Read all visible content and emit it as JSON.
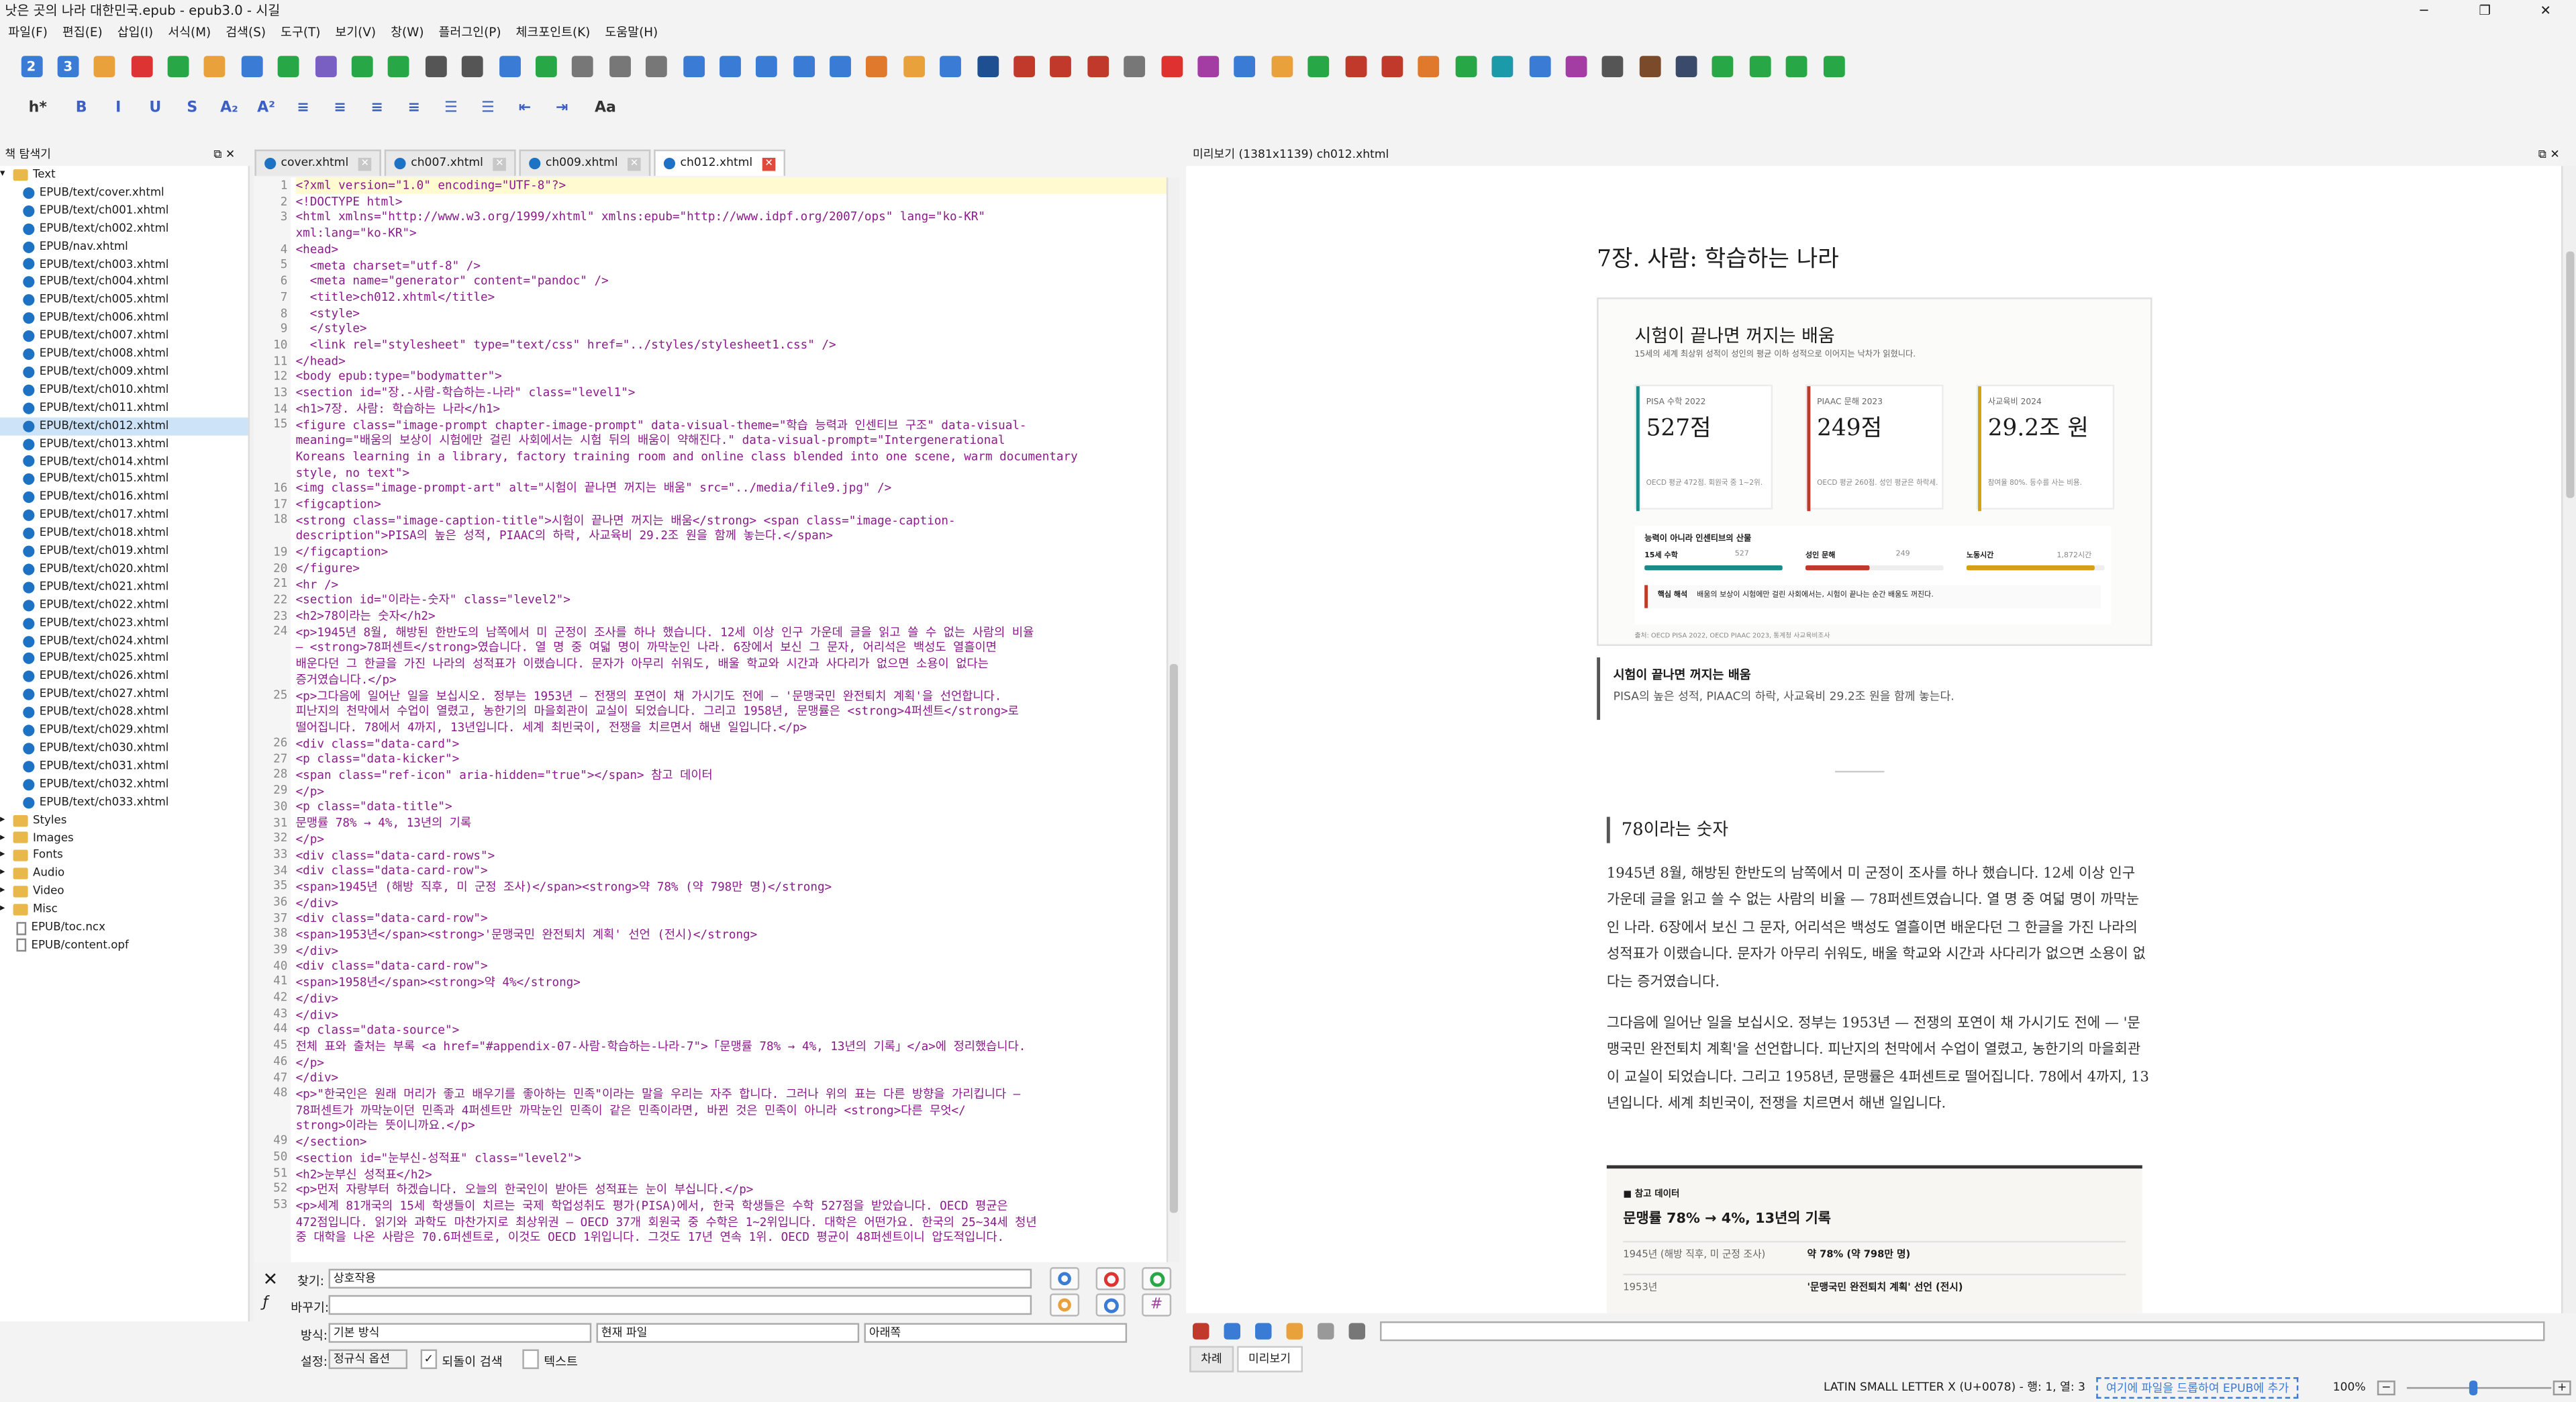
{
  "window": {
    "title": "낫은 곳의 나라 대한민국.epub - epub3.0 - 시길"
  },
  "menu": [
    "파일(F)",
    "편집(E)",
    "삽입(I)",
    "서식(M)",
    "검색(S)",
    "도구(T)",
    "보기(V)",
    "창(W)",
    "플러그인(P)",
    "체크포인트(K)",
    "도움말(H)"
  ],
  "toolbar_icons": [
    "heading-2-icon",
    "heading-3-icon",
    "open-icon",
    "save-icon",
    "add-file-icon",
    "up-icon",
    "refresh-icon",
    "add-icon",
    "gear-icon",
    "import-icon",
    "add-existing-icon",
    "metadata-icon",
    "merge-icon",
    "undo-icon",
    "redo-icon",
    "cut-icon",
    "copy-icon",
    "paste-icon",
    "code-icon",
    "close-tag-icon",
    "search-icon",
    "zoom-icon",
    "image-icon",
    "media-icon",
    "omega-icon",
    "anchor-icon",
    "spellcheck-icon",
    "replace-icon",
    "link-icon",
    "bookmark-icon",
    "back-icon",
    "heart-icon",
    "mail-icon",
    "list-icon",
    "toc-icon",
    "abc-check-icon",
    "plugin-1-icon",
    "plugin-2-icon",
    "plugin-3-icon",
    "plugin-4-icon",
    "plugin-5-icon",
    "plugin-6-icon",
    "plugin-7-icon",
    "plugin-8-icon",
    "plugin-9-icon",
    "plugin-10-icon",
    "plugin-11-icon",
    "tag-1-icon",
    "tag-2-icon",
    "tag-3-icon"
  ],
  "toolbar_colors": [
    "#3a7bd5",
    "#3a7bd5",
    "#e9a23b",
    "#d33",
    "#27a745",
    "#e9a23b",
    "#3a7bd5",
    "#27a745",
    "#7a5fc2",
    "#27a745",
    "#27a745",
    "#555",
    "#555",
    "#3a7bd5",
    "#27a745",
    "#777",
    "#777",
    "#777",
    "#3a7bd5",
    "#3a7bd5",
    "#3a7bd5",
    "#3a7bd5",
    "#3a7bd5",
    "#e0792b",
    "#e9a23b",
    "#3a7bd5",
    "#1d4f91",
    "#c0392b",
    "#c0392b",
    "#c0392b",
    "#777",
    "#e03131",
    "#a33da3",
    "#3a7bd5",
    "#e9a23b",
    "#27a745",
    "#c0392b",
    "#c0392b",
    "#e0792b",
    "#27a745",
    "#1b9aaa",
    "#3a7bd5",
    "#a33da3",
    "#555",
    "#7a4a2a",
    "#3a4a6a",
    "#27a745",
    "#27a745",
    "#27a745",
    "#27a745"
  ],
  "toolbar_badges": [
    "2",
    "3"
  ],
  "format_toolbar": [
    "h*",
    "B",
    "I",
    "U",
    "S",
    "A₂",
    "A²",
    "≡",
    "≡",
    "≡",
    "≡",
    "☰",
    "☰",
    "⇤",
    "⇥",
    "Aa"
  ],
  "explorer": {
    "title": "책 탐색기",
    "root": "Text",
    "files": [
      "EPUB/text/cover.xhtml",
      "EPUB/text/ch001.xhtml",
      "EPUB/text/ch002.xhtml",
      "EPUB/nav.xhtml",
      "EPUB/text/ch003.xhtml",
      "EPUB/text/ch004.xhtml",
      "EPUB/text/ch005.xhtml",
      "EPUB/text/ch006.xhtml",
      "EPUB/text/ch007.xhtml",
      "EPUB/text/ch008.xhtml",
      "EPUB/text/ch009.xhtml",
      "EPUB/text/ch010.xhtml",
      "EPUB/text/ch011.xhtml",
      "EPUB/text/ch012.xhtml",
      "EPUB/text/ch013.xhtml",
      "EPUB/text/ch014.xhtml",
      "EPUB/text/ch015.xhtml",
      "EPUB/text/ch016.xhtml",
      "EPUB/text/ch017.xhtml",
      "EPUB/text/ch018.xhtml",
      "EPUB/text/ch019.xhtml",
      "EPUB/text/ch020.xhtml",
      "EPUB/text/ch021.xhtml",
      "EPUB/text/ch022.xhtml",
      "EPUB/text/ch023.xhtml",
      "EPUB/text/ch024.xhtml",
      "EPUB/text/ch025.xhtml",
      "EPUB/text/ch026.xhtml",
      "EPUB/text/ch027.xhtml",
      "EPUB/text/ch028.xhtml",
      "EPUB/text/ch029.xhtml",
      "EPUB/text/ch030.xhtml",
      "EPUB/text/ch031.xhtml",
      "EPUB/text/ch032.xhtml",
      "EPUB/text/ch033.xhtml"
    ],
    "selected_index": 13,
    "folders": [
      "Styles",
      "Images",
      "Fonts",
      "Audio",
      "Video",
      "Misc"
    ],
    "extra": [
      "EPUB/toc.ncx",
      "EPUB/content.opf"
    ]
  },
  "tabs": [
    {
      "label": "cover.xhtml"
    },
    {
      "label": "ch007.xhtml"
    },
    {
      "label": "ch009.xhtml"
    },
    {
      "label": "ch012.xhtml",
      "active": true
    }
  ],
  "code_lines": [
    "<?xml version=\"1.0\" encoding=\"UTF-8\"?>",
    "<!DOCTYPE html>",
    "<html xmlns=\"http://www.w3.org/1999/xhtml\" xmlns:epub=\"http://www.idpf.org/2007/ops\" lang=\"ko-KR\"",
    "xml:lang=\"ko-KR\">",
    "<head>",
    "  <meta charset=\"utf-8\" />",
    "  <meta name=\"generator\" content=\"pandoc\" />",
    "  <title>ch012.xhtml</title>",
    "  <style>",
    "  </style>",
    "  <link rel=\"stylesheet\" type=\"text/css\" href=\"../styles/stylesheet1.css\" />",
    "</head>",
    "<body epub:type=\"bodymatter\">",
    "<section id=\"장.-사람-학습하는-나라\" class=\"level1\">",
    "<h1>7장. 사람: 학습하는 나라</h1>",
    "<figure class=\"image-prompt chapter-image-prompt\" data-visual-theme=\"학습 능력과 인센티브 구조\" data-visual-",
    "meaning=\"배움의 보상이 시험에만 걸린 사회에서는 시험 뒤의 배움이 약해진다.\" data-visual-prompt=\"Intergenerational",
    "Koreans learning in a library, factory training room and online class blended into one scene, warm documentary",
    "style, no text\">",
    "<img class=\"image-prompt-art\" alt=\"시험이 끝나면 꺼지는 배움\" src=\"../media/file9.jpg\" />",
    "<figcaption>",
    "<strong class=\"image-caption-title\">시험이 끝나면 꺼지는 배움</strong> <span class=\"image-caption-",
    "description\">PISA의 높은 성적, PIAAC의 하락, 사교육비 29.2조 원을 함께 놓는다.</span>",
    "</figcaption>",
    "</figure>",
    "<hr />",
    "<section id=\"이라는-숫자\" class=\"level2\">",
    "<h2>78이라는 숫자</h2>",
    "<p>1945년 8월, 해방된 한반도의 남쪽에서 미 군정이 조사를 하나 했습니다. 12세 이상 인구 가운데 글을 읽고 쓸 수 없는 사람의 비율",
    "— <strong>78퍼센트</strong>였습니다. 열 명 중 여덟 명이 까막눈인 나라. 6장에서 보신 그 문자, 어리석은 백성도 열흘이면",
    "배운다던 그 한글을 가진 나라의 성적표가 이랬습니다. 문자가 아무리 쉬워도, 배울 학교와 시간과 사다리가 없으면 소용이 없다는",
    "증거였습니다.</p>",
    "<p>그다음에 일어난 일을 보십시오. 정부는 1953년 — 전쟁의 포연이 채 가시기도 전에 — '문맹국민 완전퇴치 계획'을 선언합니다.",
    "피난지의 천막에서 수업이 열렸고, 농한기의 마을회관이 교실이 되었습니다. 그리고 1958년, 문맹률은 <strong>4퍼센트</strong>로",
    "떨어집니다. 78에서 4까지, 13년입니다. 세계 최빈국이, 전쟁을 치르면서 해낸 일입니다.</p>",
    "<div class=\"data-card\">",
    "<p class=\"data-kicker\">",
    "<span class=\"ref-icon\" aria-hidden=\"true\"></span> 참고 데이터",
    "</p>",
    "<p class=\"data-title\">",
    "문맹률 78% → 4%, 13년의 기록",
    "</p>",
    "<div class=\"data-card-rows\">",
    "<div class=\"data-card-row\">",
    "<span>1945년 (해방 직후, 미 군정 조사)</span><strong>약 78% (약 798만 명)</strong>",
    "</div>",
    "<div class=\"data-card-row\">",
    "<span>1953년</span><strong>'문맹국민 완전퇴치 계획' 선언 (전시)</strong>",
    "</div>",
    "<div class=\"data-card-row\">",
    "<span>1958년</span><strong>약 4%</strong>",
    "</div>",
    "</div>",
    "<p class=\"data-source\">",
    "전체 표와 출처는 부록 <a href=\"#appendix-07-사람-학습하는-나라-7\">「문맹률 78% → 4%, 13년의 기록」</a>에 정리했습니다.",
    "</p>",
    "</div>",
    "<p>\"한국인은 원래 머리가 좋고 배우기를 좋아하는 민족\"이라는 말을 우리는 자주 합니다. 그러나 위의 표는 다른 방향을 가리킵니다 —",
    "78퍼센트가 까막눈이던 민족과 4퍼센트만 까막눈인 민족이 같은 민족이라면, 바뀐 것은 민족이 아니라 <strong>다른 무엇</",
    "strong>이라는 뜻이니까요.</p>",
    "</section>",
    "<section id=\"눈부신-성적표\" class=\"level2\">",
    "<h2>눈부신 성적표</h2>",
    "<p>먼저 자랑부터 하겠습니다. 오늘의 한국인이 받아든 성적표는 눈이 부십니다.</p>",
    "<p>세계 81개국의 15세 학생들이 치르는 국제 학업성취도 평가(PISA)에서, 한국 학생들은 수학 527점을 받았습니다. OECD 평균은",
    "472점입니다. 읽기와 과학도 마찬가지로 최상위권 — OECD 37개 회원국 중 수학은 1~2위입니다. 대학은 어떤가요. 한국의 25~34세 청년",
    "중 대학을 나온 사람은 70.6퍼센트로, 이것도 OECD 1위입니다. 그것도 17년 연속 1위. OECD 평균이 48퍼센트이니 압도적입니다."
  ],
  "gutter_numbers": [
    "1",
    "2",
    "3",
    "",
    "4",
    "5",
    "6",
    "7",
    "8",
    "9",
    "10",
    "11",
    "12",
    "13",
    "14",
    "15",
    "",
    "",
    "",
    "16",
    "17",
    "18",
    "",
    "19",
    "20",
    "21",
    "22",
    "23",
    "24",
    "",
    "",
    "",
    "25",
    "",
    "",
    "26",
    "27",
    "28",
    "29",
    "30",
    "31",
    "32",
    "33",
    "34",
    "35",
    "36",
    "37",
    "38",
    "39",
    "40",
    "41",
    "42",
    "43",
    "44",
    "45",
    "46",
    "47",
    "48",
    "",
    "",
    "49",
    "50",
    "51",
    "52",
    "53",
    "",
    "",
    ""
  ],
  "find": {
    "find_label": "찾기:",
    "find_value": "상호작용",
    "replace_label": "바꾸기:",
    "replace_value": "",
    "mode_label": "방식:",
    "mode_value": "기본 방식",
    "scope_value": "현재 파일",
    "direction_value": "아래쪽",
    "settings_label": "설정:",
    "regex_option": "정규식 옵션",
    "wrap_label": "되돌이 검색",
    "text_label": "텍스트"
  },
  "preview": {
    "title": "미리보기 (1381x1139) ch012.xhtml",
    "h1": "7장. 사람: 학습하는 나라",
    "infographic": {
      "title": "시험이 끝나면 꺼지는 배움",
      "subtitle": "15세의 세계 최상위 성적이 성인의 평균 이하 성적으로 이어지는 낙차가 읽혔니다.",
      "stats": [
        {
          "label": "PISA 수학 2022",
          "value": "527점",
          "note": "OECD 평균 472점. 회원국 중 1~2위.",
          "color": "#1b8a8a"
        },
        {
          "label": "PIAAC 문해 2023",
          "value": "249점",
          "note": "OECD 평균 260점. 성인 평균은 하락세.",
          "color": "#c0392b"
        },
        {
          "label": "사교육비 2024",
          "value": "29.2조 원",
          "note": "참여율 80%. 등수를 사는 비용.",
          "color": "#d4a017"
        }
      ],
      "chain_title": "능력이 아니라 인센티브의 산물",
      "chain": [
        {
          "label": "15세 수학",
          "value": "527",
          "color": "#1b8a8a",
          "fill": 1.0
        },
        {
          "label": "성인 문해",
          "value": "249",
          "color": "#c0392b",
          "fill": 0.47
        },
        {
          "label": "노동시간",
          "value": "1,872시간",
          "color": "#d4a017",
          "fill": 0.93
        }
      ],
      "insight_label": "핵심 해석",
      "insight": "배움의 보상이 시험에만 걸린 사회에서는, 시험이 끝나는 순간 배움도 꺼진다.",
      "source": "출처: OECD PISA 2022, OECD PIAAC 2023, 통계청 사교육비조사"
    },
    "caption_title": "시험이 끝나면 꺼지는 배움",
    "caption_desc": "PISA의 높은 성적, PIAAC의 하락, 사교육비 29.2조 원을 함께 놓는다.",
    "h2": "78이라는 숫자",
    "p1": "1945년 8월, 해방된 한반도의 남쪽에서 미 군정이 조사를 하나 했습니다. 12세 이상 인구 가운데 글을 읽고 쓸 수 없는 사람의 비율 — 78퍼센트였습니다. 열 명 중 여덟 명이 까막눈인 나라. 6장에서 보신 그 문자, 어리석은 백성도 열흘이면 배운다던 그 한글을 가진 나라의 성적표가 이랬습니다. 문자가 아무리 쉬워도, 배울 학교와 시간과 사다리가 없으면 소용이 없다는 증거였습니다.",
    "p2": "그다음에 일어난 일을 보십시오. 정부는 1953년 — 전쟁의 포연이 채 가시기도 전에 — '문맹국민 완전퇴치 계획'을 선언합니다. 피난지의 천막에서 수업이 열렸고, 농한기의 마을회관이 교실이 되었습니다. 그리고 1958년, 문맹률은 4퍼센트로 떨어집니다. 78에서 4까지, 13년입니다. 세계 최빈국이, 전쟁을 치르면서 해낸 일입니다.",
    "datacard": {
      "kicker": "참고 데이터",
      "title": "문맹률 78% → 4%, 13년의 기록",
      "rows": [
        {
          "k": "1945년 (해방 직후, 미 군정 조사)",
          "v": "약 78% (약 798만 명)"
        },
        {
          "k": "1953년",
          "v": "'문맹국민 완전퇴치 계획' 선언 (전시)"
        }
      ]
    }
  },
  "bottom_tabs": [
    "차례",
    "미리보기"
  ],
  "status": {
    "char": "LATIN SMALL LETTER X (U+0078) - 행: 1, 열: 3",
    "drop_hint": "여기에 파일을 드롭하여 EPUB에 추가",
    "zoom": "100%"
  }
}
